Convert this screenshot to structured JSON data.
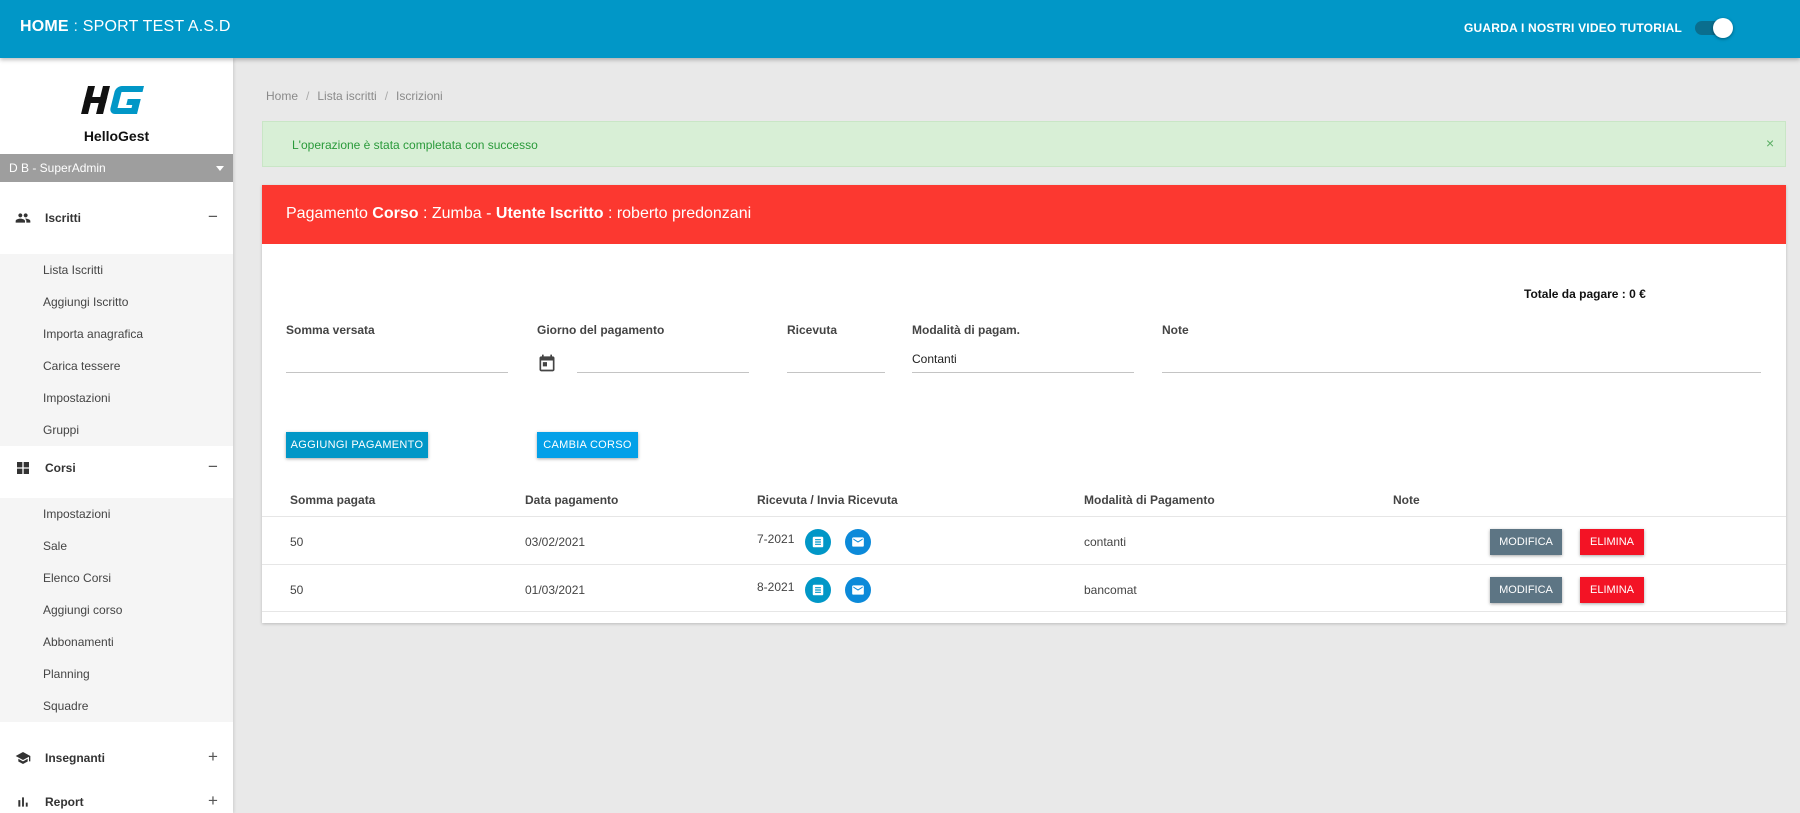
{
  "topbar": {
    "home_label": "HOME",
    "separator": ":",
    "org_name": "SPORT TEST A.S.D",
    "tutorial_label": "GUARDA I NOSTRI VIDEO TUTORIAL",
    "toggle_on": true
  },
  "sidebar": {
    "logo_letters": "HG",
    "brand": "HelloGest",
    "user": "D B - SuperAdmin",
    "sections": [
      {
        "label": "Iscritti",
        "icon": "people-icon",
        "expanded": true,
        "toggle": "−",
        "items": [
          "Lista Iscritti",
          "Aggiungi Iscritto",
          "Importa anagrafica",
          "Carica tessere",
          "Impostazioni",
          "Gruppi"
        ]
      },
      {
        "label": "Corsi",
        "icon": "dashboard-icon",
        "expanded": true,
        "toggle": "−",
        "items": [
          "Impostazioni",
          "Sale",
          "Elenco Corsi",
          "Aggiungi corso",
          "Abbonamenti",
          "Planning",
          "Squadre"
        ]
      },
      {
        "label": "Insegnanti",
        "icon": "school-icon",
        "expanded": false,
        "toggle": "+"
      },
      {
        "label": "Report",
        "icon": "bar-chart-icon",
        "expanded": false,
        "toggle": "+"
      }
    ]
  },
  "breadcrumb": [
    "Home",
    "Lista iscritti",
    "Iscrizioni"
  ],
  "alert": {
    "message": "L'operazione è stata completata con successo",
    "close": "×"
  },
  "card": {
    "header": {
      "prefix": "Pagamento",
      "course_label": "Corso",
      "course_value": ": Zumba -",
      "user_label": "Utente Iscritto",
      "user_value": ": roberto predonzani"
    },
    "total": "Totale da pagare : 0 €",
    "form": {
      "amount_label": "Somma versata",
      "amount_value": "",
      "date_label": "Giorno del pagamento",
      "date_value": "",
      "receipt_label": "Ricevuta",
      "receipt_value": "",
      "method_label": "Modalità di pagam.",
      "method_value": "Contanti",
      "notes_label": "Note",
      "notes_value": ""
    },
    "buttons": {
      "add": "AGGIUNGI PAGAMENTO",
      "change": "CAMBIA CORSO"
    },
    "table": {
      "headers": [
        "Somma pagata",
        "Data pagamento",
        "Ricevuta / Invia Ricevuta",
        "Modalità di Pagamento",
        "Note"
      ],
      "rows": [
        {
          "amount": "50",
          "date": "03/02/2021",
          "receipt": "7-2021",
          "method": "contanti",
          "notes": ""
        },
        {
          "amount": "50",
          "date": "01/03/2021",
          "receipt": "8-2021",
          "method": "bancomat",
          "notes": ""
        }
      ],
      "edit_label": "MODIFICA",
      "delete_label": "ELIMINA"
    }
  },
  "colors": {
    "topbar": "#0197c7",
    "card_header": "#fc3830",
    "alert_bg": "#d8efd6",
    "alert_text": "#2a9a3a",
    "edit_button": "#5d7584",
    "delete_button": "#f31325"
  }
}
